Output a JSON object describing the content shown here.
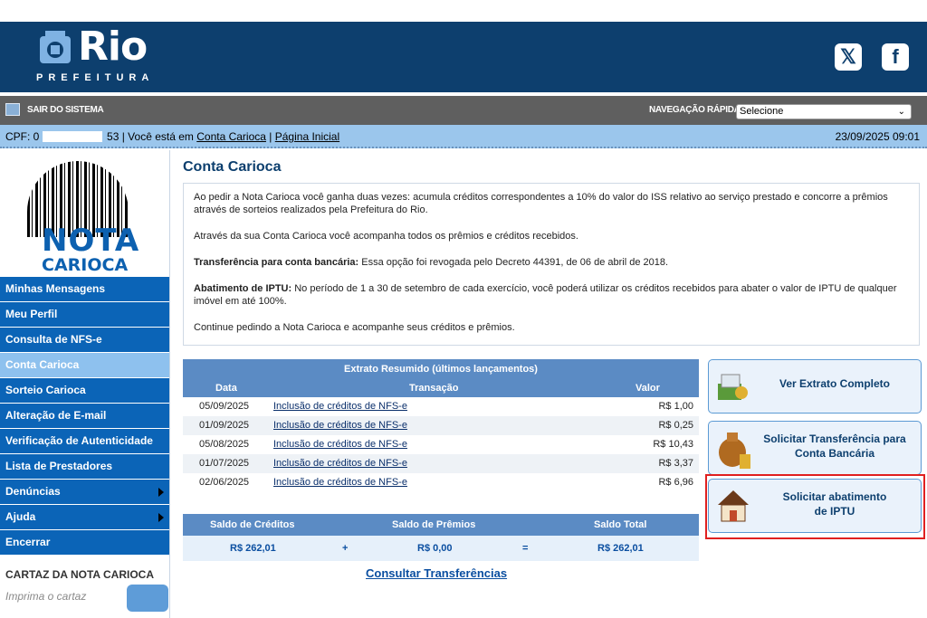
{
  "header": {
    "logo_text": "Rio",
    "logo_sub": "PREFEITURA",
    "social": [
      {
        "icon": "twitter-icon",
        "glyph": "𝕏"
      },
      {
        "icon": "facebook-icon",
        "glyph": "f"
      }
    ]
  },
  "toolbar": {
    "exit_label": "SAIR DO SISTEMA",
    "nav_label": "NAVEGAÇÃO RÁPIDA",
    "nav_select_value": "Selecione"
  },
  "infobar": {
    "cpf_prefix": "CPF: 0",
    "cpf_suffix": "53",
    "location_text": " | Você está em ",
    "crumb1": "Conta Carioca",
    "separator": " | ",
    "crumb2": "Página Inicial",
    "datetime": "23/09/2025 09:01"
  },
  "sidebar": {
    "logo_word1": "NOTA",
    "logo_word2": "CARIOCA",
    "items": [
      {
        "label": "Minhas Mensagens"
      },
      {
        "label": "Meu Perfil"
      },
      {
        "label": "Consulta de NFS-e"
      },
      {
        "label": "Conta Carioca"
      },
      {
        "label": "Sorteio Carioca"
      },
      {
        "label": "Alteração de E-mail"
      },
      {
        "label": "Verificação de Autenticidade"
      },
      {
        "label": "Lista de Prestadores"
      },
      {
        "label": "Denúncias"
      },
      {
        "label": "Ajuda"
      },
      {
        "label": "Encerrar"
      }
    ],
    "cartaz_title": "CARTAZ DA NOTA CARIOCA",
    "cartaz_sub": "Imprima o cartaz"
  },
  "main": {
    "title": "Conta Carioca",
    "p1": "Ao pedir a Nota Carioca você ganha duas vezes: acumula créditos correspondentes a 10% do valor do ISS relativo ao serviço prestado e concorre a prêmios através de sorteios realizados pela Prefeitura do Rio.",
    "p2": "Através da sua Conta Carioca você acompanha todos os prêmios e créditos recebidos.",
    "p3_bold": "Transferência para conta bancária:",
    "p3_text": " Essa opção foi revogada pelo Decreto 44391, de 06 de abril de 2018.",
    "p4_bold": "Abatimento de IPTU:",
    "p4_text": " No período de 1 a 30 de setembro de cada exercício, você poderá utilizar os créditos recebidos para abater o valor de IPTU de qualquer imóvel em até 100%.",
    "p5": "Continue pedindo a Nota Carioca e acompanhe seus créditos e prêmios."
  },
  "extrato": {
    "title": "Extrato Resumido (últimos lançamentos)",
    "col_data": "Data",
    "col_transacao": "Transação",
    "col_valor": "Valor",
    "rows": [
      {
        "data": "05/09/2025",
        "transacao": "Inclusão de créditos de NFS-e",
        "valor": "R$ 1,00"
      },
      {
        "data": "01/09/2025",
        "transacao": "Inclusão de créditos de NFS-e",
        "valor": "R$ 0,25"
      },
      {
        "data": "05/08/2025",
        "transacao": "Inclusão de créditos de NFS-e",
        "valor": "R$ 10,43"
      },
      {
        "data": "01/07/2025",
        "transacao": "Inclusão de créditos de NFS-e",
        "valor": "R$ 3,37"
      },
      {
        "data": "02/06/2025",
        "transacao": "Inclusão de créditos de NFS-e",
        "valor": "R$ 6,96"
      }
    ]
  },
  "saldo": {
    "h_creditos": "Saldo de Créditos",
    "h_premios": "Saldo de Prêmios",
    "h_total": "Saldo Total",
    "v_creditos": "R$ 262,01",
    "plus": "+",
    "v_premios": "R$ 0,00",
    "equals": "=",
    "v_total": "R$ 262,01"
  },
  "consultar_label": "Consultar Transferências",
  "actions": {
    "ver_extrato": "Ver Extrato Completo",
    "transferencia_l1": "Solicitar Transferência para",
    "transferencia_l2": "Conta Bancária",
    "iptu_l1": "Solicitar abatimento",
    "iptu_l2": "de IPTU"
  },
  "colors": {
    "header_blue": "#0d3f6e",
    "menu_blue": "#0b64b7",
    "menu_active": "#8ec1ee",
    "highlight_red": "#e02020"
  }
}
